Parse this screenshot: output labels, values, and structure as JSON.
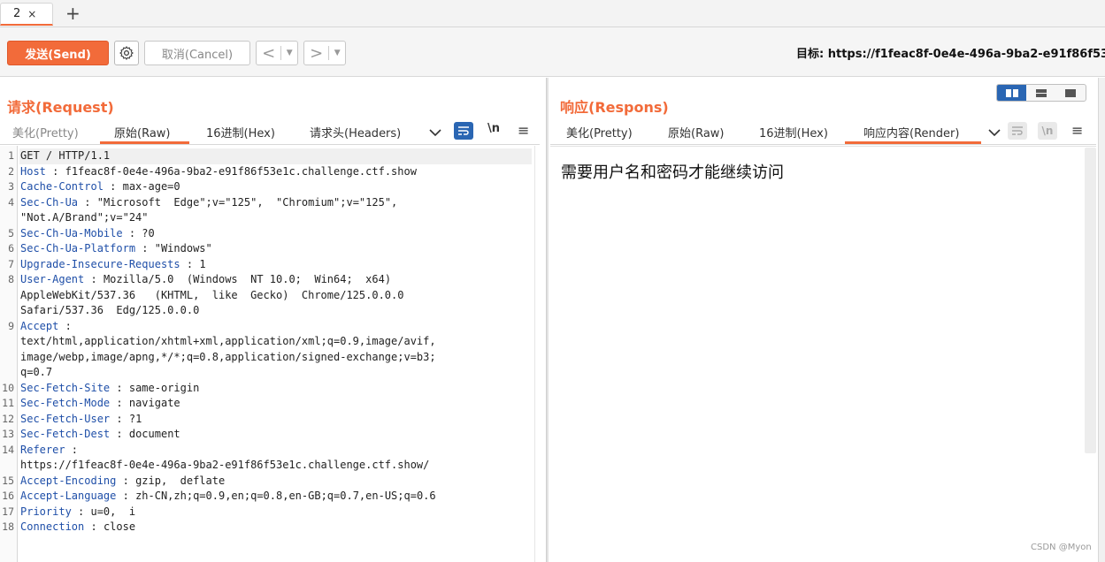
{
  "tabs": {
    "active_label": "2",
    "close_glyph": "×",
    "add_glyph": "+"
  },
  "toolbar": {
    "send_label": "发送(Send)",
    "cancel_label": "取消(Cancel)",
    "back_glyph": "<",
    "forward_glyph": ">",
    "dropdown_glyph": "▼",
    "target_label": "目标:",
    "target_url": "https://f1feac8f-0e4e-496a-9ba2-e91f86f53"
  },
  "request": {
    "title": "请求(Request)",
    "tabs": [
      "美化(Pretty)",
      "原始(Raw)",
      "16进制(Hex)",
      "请求头(Headers)"
    ],
    "active_tab": "原始(Raw)",
    "newline_label": "\\n",
    "menu_glyph": "≡",
    "lines": [
      {
        "n": "1",
        "name": "",
        "sep": "",
        "value": "GET / HTTP/1.1"
      },
      {
        "n": "2",
        "name": "Host",
        "sep": " : ",
        "value": "f1feac8f-0e4e-496a-9ba2-e91f86f53e1c.challenge.ctf.show"
      },
      {
        "n": "3",
        "name": "Cache-Control",
        "sep": " : ",
        "value": "max-age=0"
      },
      {
        "n": "4",
        "name": "Sec-Ch-Ua",
        "sep": " : ",
        "value": "\"Microsoft  Edge\";v=\"125\",  \"Chromium\";v=\"125\","
      },
      {
        "n": "",
        "name": "",
        "sep": "",
        "value": "\"Not.A/Brand\";v=\"24\""
      },
      {
        "n": "5",
        "name": "Sec-Ch-Ua-Mobile",
        "sep": " : ",
        "value": "?0"
      },
      {
        "n": "6",
        "name": "Sec-Ch-Ua-Platform",
        "sep": " : ",
        "value": "\"Windows\""
      },
      {
        "n": "7",
        "name": "Upgrade-Insecure-Requests",
        "sep": " : ",
        "value": "1"
      },
      {
        "n": "8",
        "name": "User-Agent",
        "sep": " : ",
        "value": "Mozilla/5.0  (Windows  NT 10.0;  Win64;  x64)"
      },
      {
        "n": "",
        "name": "",
        "sep": "",
        "value": "AppleWebKit/537.36   (KHTML,  like  Gecko)  Chrome/125.0.0.0"
      },
      {
        "n": "",
        "name": "",
        "sep": "",
        "value": "Safari/537.36  Edg/125.0.0.0"
      },
      {
        "n": "9",
        "name": "Accept",
        "sep": " :",
        "value": ""
      },
      {
        "n": "",
        "name": "",
        "sep": "",
        "value": "text/html,application/xhtml+xml,application/xml;q=0.9,image/avif,"
      },
      {
        "n": "",
        "name": "",
        "sep": "",
        "value": "image/webp,image/apng,*/*;q=0.8,application/signed-exchange;v=b3;"
      },
      {
        "n": "",
        "name": "",
        "sep": "",
        "value": "q=0.7"
      },
      {
        "n": "10",
        "name": "Sec-Fetch-Site",
        "sep": " : ",
        "value": "same-origin"
      },
      {
        "n": "11",
        "name": "Sec-Fetch-Mode",
        "sep": " : ",
        "value": "navigate"
      },
      {
        "n": "12",
        "name": "Sec-Fetch-User",
        "sep": " : ",
        "value": "?1"
      },
      {
        "n": "13",
        "name": "Sec-Fetch-Dest",
        "sep": " : ",
        "value": "document"
      },
      {
        "n": "14",
        "name": "Referer",
        "sep": " :",
        "value": ""
      },
      {
        "n": "",
        "name": "",
        "sep": "",
        "value": "https://f1feac8f-0e4e-496a-9ba2-e91f86f53e1c.challenge.ctf.show/"
      },
      {
        "n": "15",
        "name": "Accept-Encoding",
        "sep": " : ",
        "value": "gzip,  deflate"
      },
      {
        "n": "16",
        "name": "Accept-Language",
        "sep": " : ",
        "value": "zh-CN,zh;q=0.9,en;q=0.8,en-GB;q=0.7,en-US;q=0.6"
      },
      {
        "n": "17",
        "name": "Priority",
        "sep": " : ",
        "value": "u=0,  i"
      },
      {
        "n": "18",
        "name": "Connection",
        "sep": " : ",
        "value": "close"
      }
    ]
  },
  "response": {
    "title": "响应(Respons)",
    "tabs": [
      "美化(Pretty)",
      "原始(Raw)",
      "16进制(Hex)",
      "响应内容(Render)"
    ],
    "active_tab": "响应内容(Render)",
    "newline_label": "\\n",
    "menu_glyph": "≡",
    "render_text": "需要用户名和密码才能继续访问"
  },
  "watermark": "CSDN @Myon⁠",
  "colors": {
    "accent": "#f26b3a",
    "header_name": "#1f4fa8",
    "toggle_blue": "#2a66b3"
  }
}
